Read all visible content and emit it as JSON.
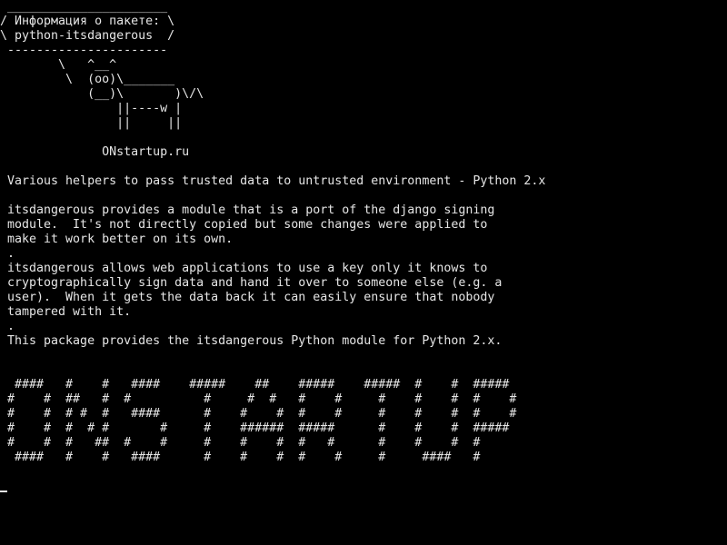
{
  "terminal": {
    "bubble": {
      "top_border": " ______________________",
      "line1": "/ Информация о пакете: \\",
      "line2": "\\ python-itsdangerous  /",
      "bottom_border": " ----------------------"
    },
    "cow": {
      "line1": "        \\   ^__^",
      "line2": "         \\  (oo)\\_______",
      "line3": "            (__)\\       )\\/\\",
      "line4": "                ||----w |",
      "line5": "                ||     ||"
    },
    "site": "              ONstartup.ru",
    "summary": " Various helpers to pass trusted data to untrusted environment - Python 2.x",
    "description": {
      "p1_line1": " itsdangerous provides a module that is a port of the django signing",
      "p1_line2": " module.  It's not directly copied but some changes were applied to",
      "p1_line3": " make it work better on its own.",
      "sep1": " .",
      "p2_line1": " itsdangerous allows web applications to use a key only it knows to",
      "p2_line2": " cryptographically sign data and hand it over to someone else (e.g. a",
      "p2_line3": " user).  When it gets the data back it can easily ensure that nobody",
      "p2_line4": " tampered with it.",
      "sep2": " .",
      "p3_line1": " This package provides the itsdangerous Python module for Python 2.x."
    },
    "banner": {
      "line1": "  ####   #    #   ####    #####    ##    #####    #####  #    #  #####",
      "line2": " #    #  ##   #  #          #     #  #   #    #     #    #    #  #    #",
      "line3": " #    #  # #  #   ####      #    #    #  #    #     #    #    #  #    #",
      "line4": " #    #  #  # #       #     #    ######  #####      #    #    #  #####",
      "line5": " #    #  #   ##  #    #     #    #    #  #   #      #    #    #  #",
      "line6": "  ####   #    #   ####      #    #    #  #    #     #     ####   #"
    },
    "cursor_char": "_"
  },
  "colors": {
    "background": "#000000",
    "foreground": "#e6e6e6"
  }
}
